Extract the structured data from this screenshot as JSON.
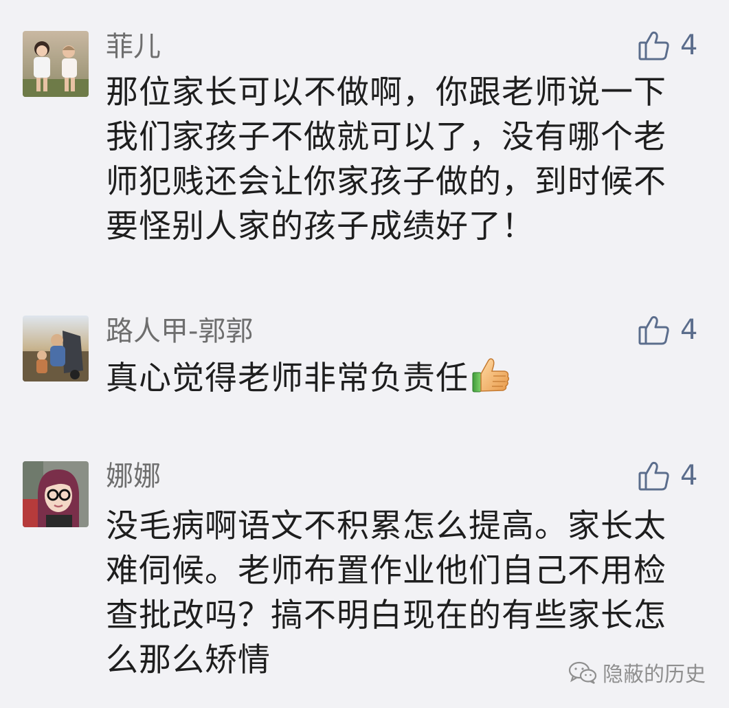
{
  "comments": [
    {
      "username": "菲儿",
      "likes": "4",
      "text": "那位家长可以不做啊，你跟老师说一下我们家孩子不做就可以了，没有哪个老师犯贱还会让你家孩子做的，到时候不要怪别人家的孩子成绩好了！",
      "avatar": "avatar-two-children"
    },
    {
      "username": "路人甲-郭郭",
      "likes": "4",
      "text": "真心觉得老师非常负责任",
      "emoji": "thumbs-up-emoji",
      "avatar": "avatar-child-stroller"
    },
    {
      "username": "娜娜",
      "likes": "4",
      "text": "没毛病啊语文不积累怎么提高。家长太难伺候。老师布置作业他们自己不用检查批改吗？搞不明白现在的有些家长怎么那么矫情",
      "avatar": "avatar-woman-glasses"
    }
  ],
  "watermark": {
    "text": "隐蔽的历史",
    "icon": "wechat-icon"
  },
  "colors": {
    "background": "#f2f2f5",
    "username": "#6e6e6e",
    "text": "#1e1e1e",
    "like": "#5b6d8c"
  }
}
